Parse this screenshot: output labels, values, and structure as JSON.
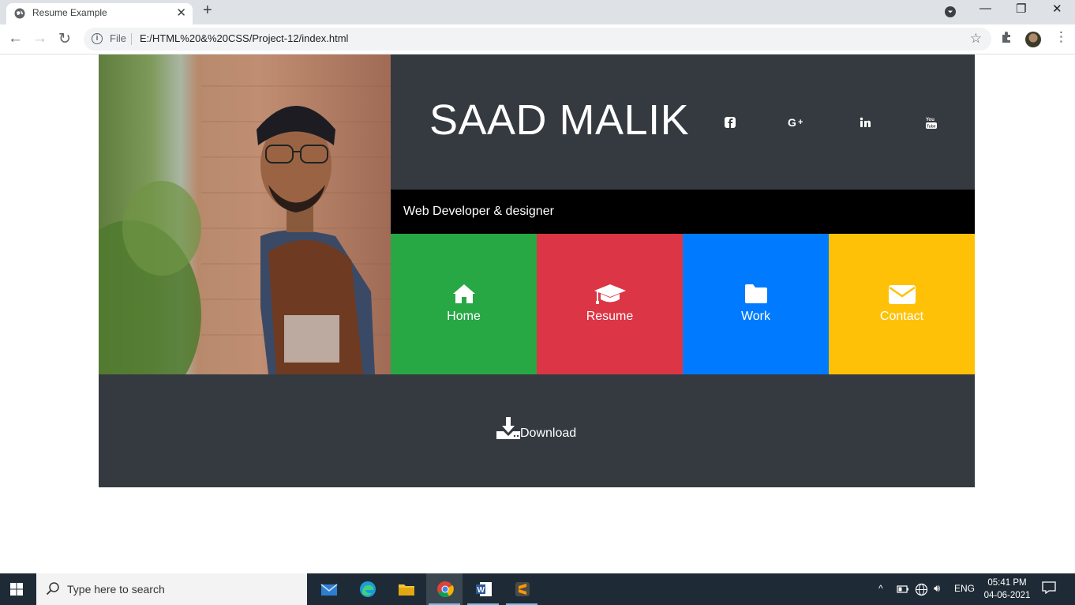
{
  "browser": {
    "tab_title": "Resume Example",
    "tab_close": "✕",
    "new_tab": "+",
    "address_scheme": "File",
    "address_url": "E:/HTML%20&%20CSS/Project-12/index.html",
    "window_controls": {
      "minimize": "—",
      "restore": "❐",
      "close": "✕"
    }
  },
  "page": {
    "name": "SAAD MALIK",
    "subtitle": "Web Developer & designer",
    "social_icons": [
      "facebook-icon",
      "google-plus-icon",
      "linkedin-icon",
      "youtube-icon"
    ],
    "nav_tiles": [
      {
        "label": "Home",
        "color": "#28a745",
        "icon": "home-icon"
      },
      {
        "label": "Resume",
        "color": "#dc3545",
        "icon": "graduation-cap-icon"
      },
      {
        "label": "Work",
        "color": "#007bff",
        "icon": "folder-icon"
      },
      {
        "label": "Contact",
        "color": "#ffc107",
        "icon": "envelope-icon"
      }
    ],
    "download_label": "Download",
    "header_bg": "#343a40"
  },
  "taskbar": {
    "search_placeholder": "Type here to search",
    "language": "ENG",
    "time": "05:41 PM",
    "date": "04-06-2021"
  }
}
